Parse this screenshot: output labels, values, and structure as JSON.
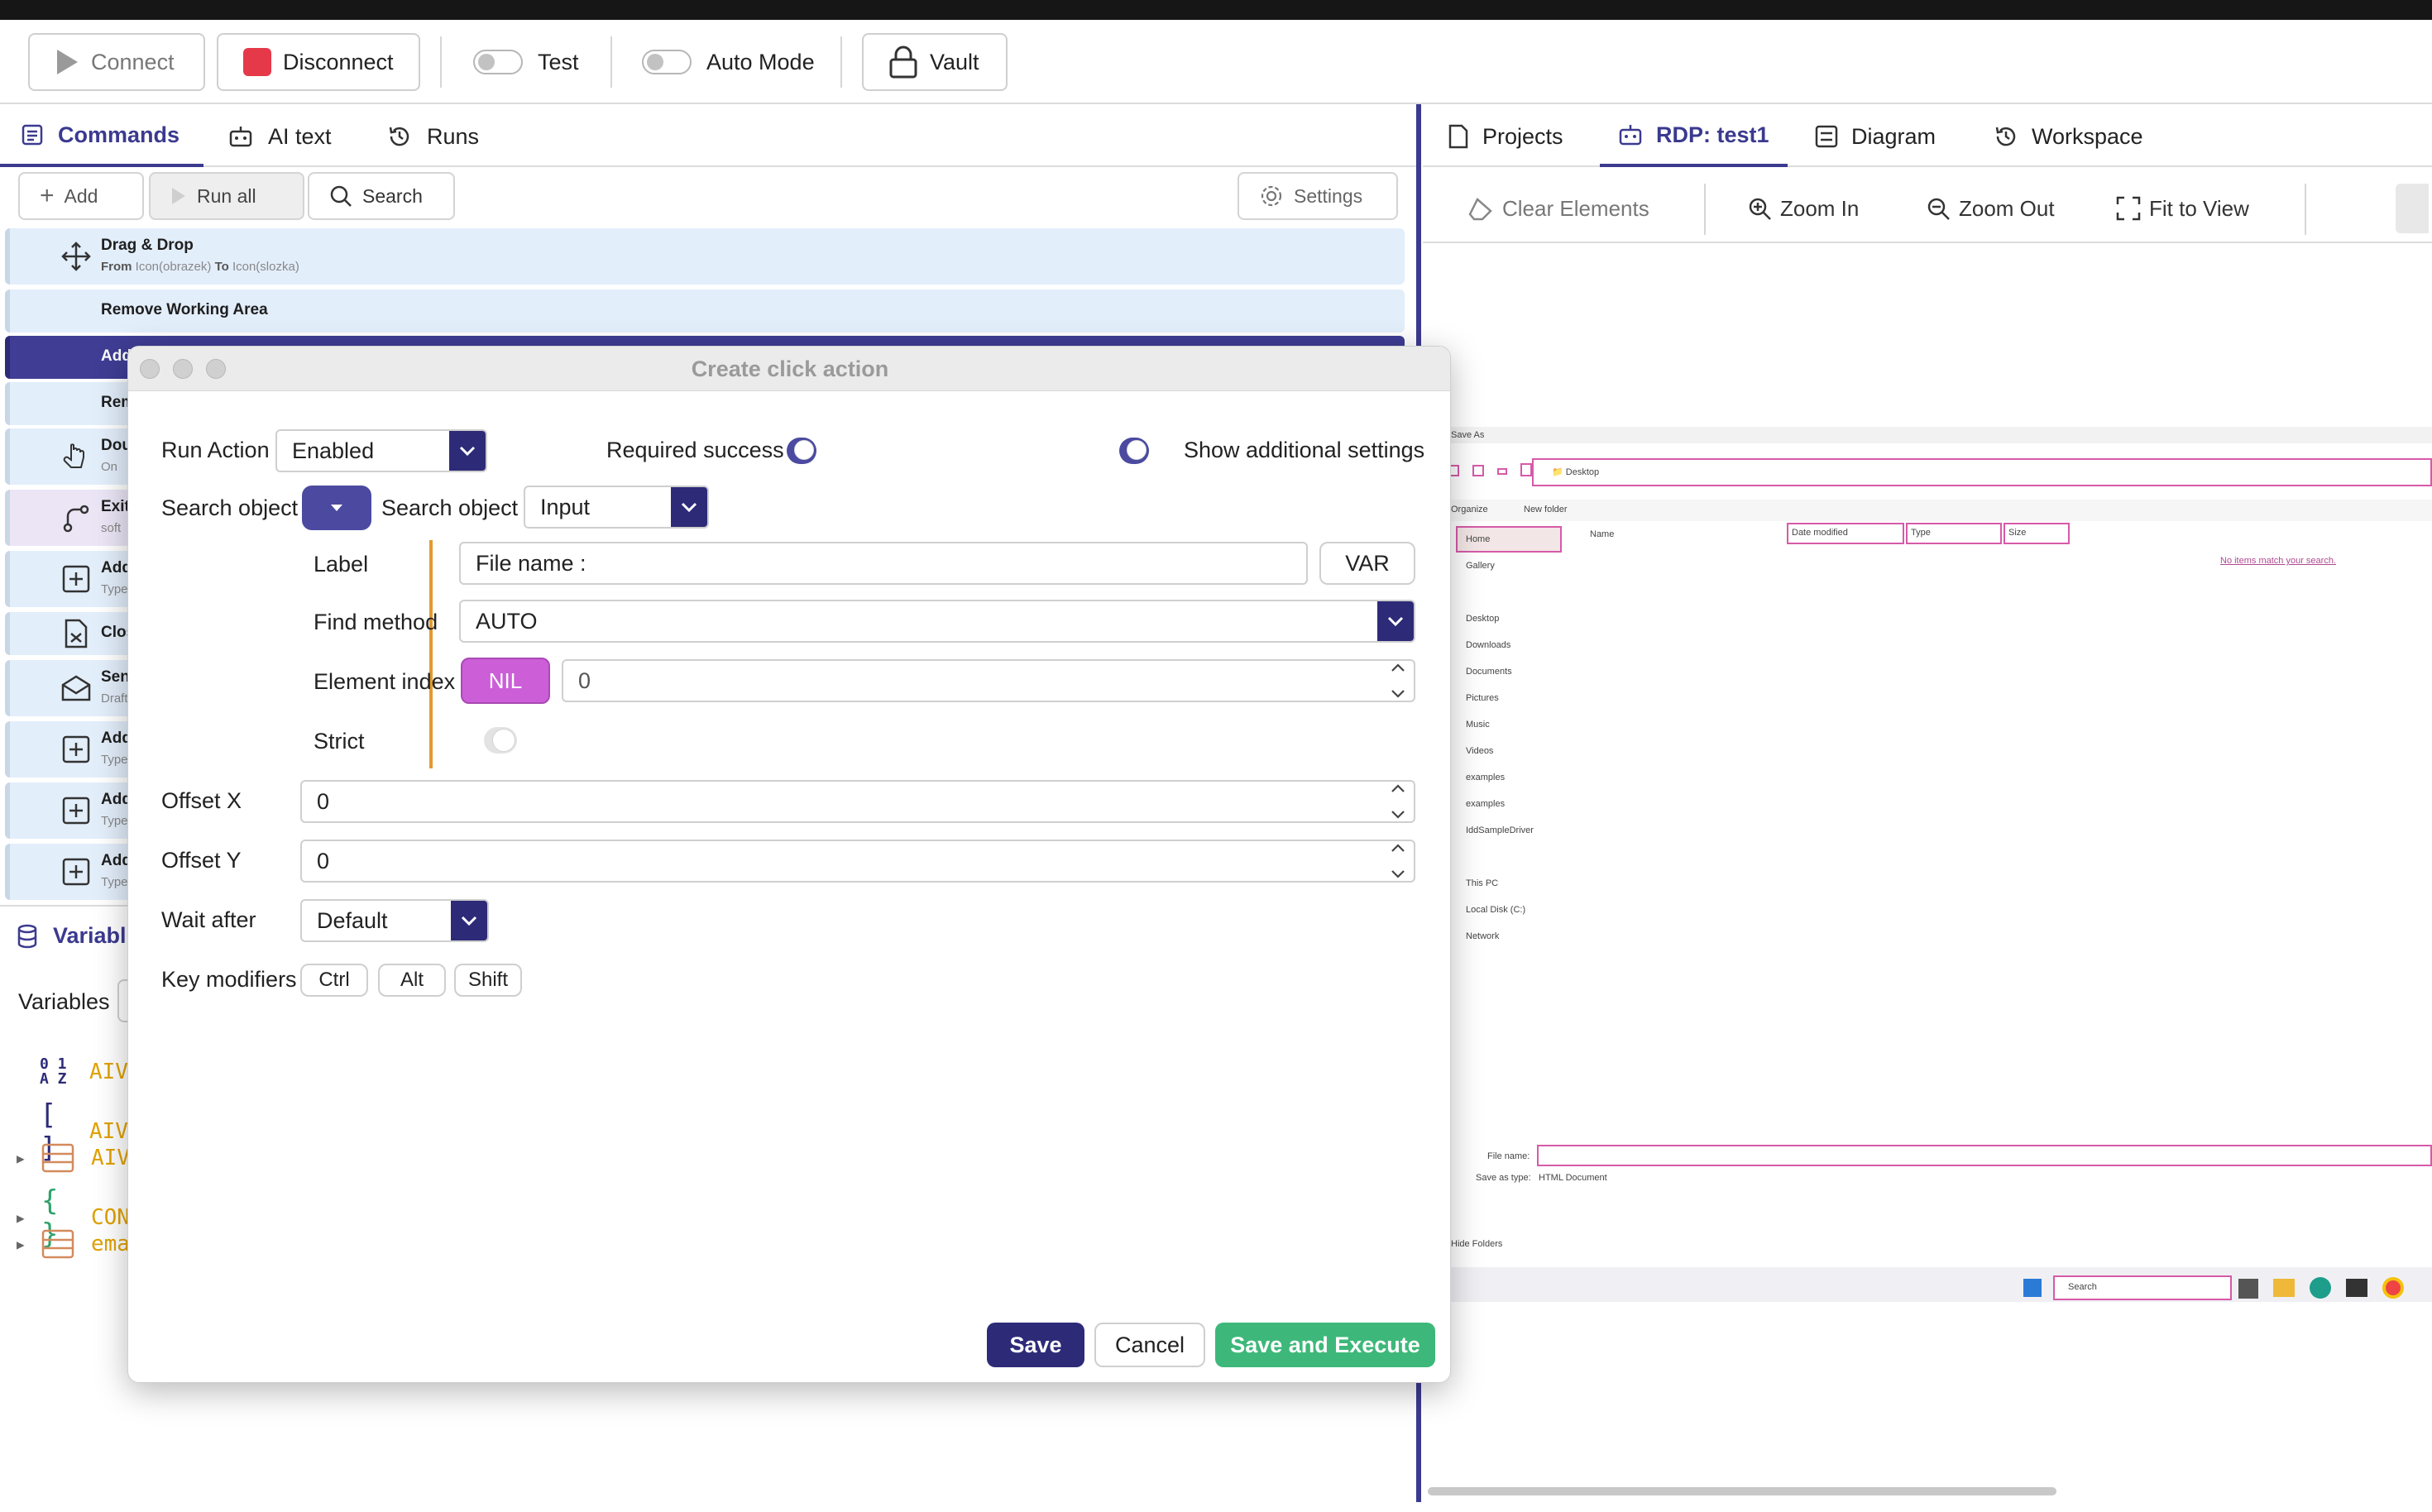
{
  "toolbar": {
    "connect": "Connect",
    "disconnect": "Disconnect",
    "test": "Test",
    "auto_mode": "Auto Mode",
    "vault": "Vault"
  },
  "left_tabs": [
    "Commands",
    "AI text",
    "Runs"
  ],
  "commands_bar": {
    "add": "Add",
    "run_all": "Run all",
    "search": "Search",
    "settings": "Settings"
  },
  "commands": [
    {
      "title": "Drag & Drop",
      "sub_from_label": "From",
      "sub_from": "Icon(obrazek)",
      "sub_to_label": "To",
      "sub_to": "Icon(slozka)"
    },
    {
      "title": "Remove Working Area",
      "sub": ""
    },
    {
      "title": "Add",
      "sub": ""
    },
    {
      "title": "Rem",
      "sub": ""
    },
    {
      "title": "Dou",
      "sub": "On"
    },
    {
      "title": "Exit",
      "sub": "soft"
    },
    {
      "title": "Add",
      "sub": "Type"
    },
    {
      "title": "Clos",
      "sub": ""
    },
    {
      "title": "Sen",
      "sub": "Draft"
    },
    {
      "title": "Add",
      "sub": "Type"
    },
    {
      "title": "Add",
      "sub": "Type"
    },
    {
      "title": "Add",
      "sub": "Type"
    }
  ],
  "variables": {
    "panel_title": "Variabl",
    "tab_label": "Variables",
    "items": [
      "AIVI",
      "AIVI",
      "AIVI",
      "CONS",
      "ema"
    ]
  },
  "right_tabs": [
    "Projects",
    "RDP: test1",
    "Diagram",
    "Workspace"
  ],
  "right_tools": {
    "clear": "Clear Elements",
    "zoom_in": "Zoom In",
    "zoom_out": "Zoom Out",
    "fit": "Fit to View"
  },
  "rdp_screen": {
    "save_as": "Save As",
    "desktop_path": "Desktop",
    "organize": "Organize",
    "new_folder": "New folder",
    "home": "Home",
    "gallery": "Gallery",
    "nav_items": [
      "Desktop",
      "Downloads",
      "Documents",
      "Pictures",
      "Music",
      "Videos",
      "examples",
      "examples",
      "IddSampleDriver"
    ],
    "this_pc": "This PC",
    "local_disk": "Local Disk (C:)",
    "network": "Network",
    "columns": [
      "Name",
      "Date modified",
      "Type",
      "Size"
    ],
    "empty_msg": "No items match your search.",
    "file_name_label": "File name:",
    "save_as_type_label": "Save as type:",
    "save_as_type_value": "HTML Document",
    "hide_folders": "Hide Folders",
    "taskbar_search": "Search"
  },
  "dialog": {
    "title": "Create click action",
    "run_action_label": "Run Action",
    "run_action_value": "Enabled",
    "required_success": "Required success",
    "show_additional": "Show additional settings",
    "search_object_label": "Search object",
    "search_object_label2": "Search object",
    "search_object_value": "Input",
    "label_label": "Label",
    "label_value": "File name :",
    "var_button": "VAR",
    "find_method_label": "Find method",
    "find_method_value": "AUTO",
    "element_index_label": "Element index",
    "nil_button": "NIL",
    "element_index_value": "0",
    "strict_label": "Strict",
    "offset_x_label": "Offset X",
    "offset_x_value": "0",
    "offset_y_label": "Offset Y",
    "offset_y_value": "0",
    "wait_after_label": "Wait after",
    "wait_after_value": "Default",
    "key_modifiers_label": "Key modifiers",
    "modifiers": [
      "Ctrl",
      "Alt",
      "Shift"
    ],
    "save": "Save",
    "cancel": "Cancel",
    "save_execute": "Save and Execute"
  },
  "colors": {
    "accent": "#3b3a8f",
    "save_execute": "#3db87a",
    "nil": "#cc5ed8",
    "disconnect": "#e5394a"
  }
}
